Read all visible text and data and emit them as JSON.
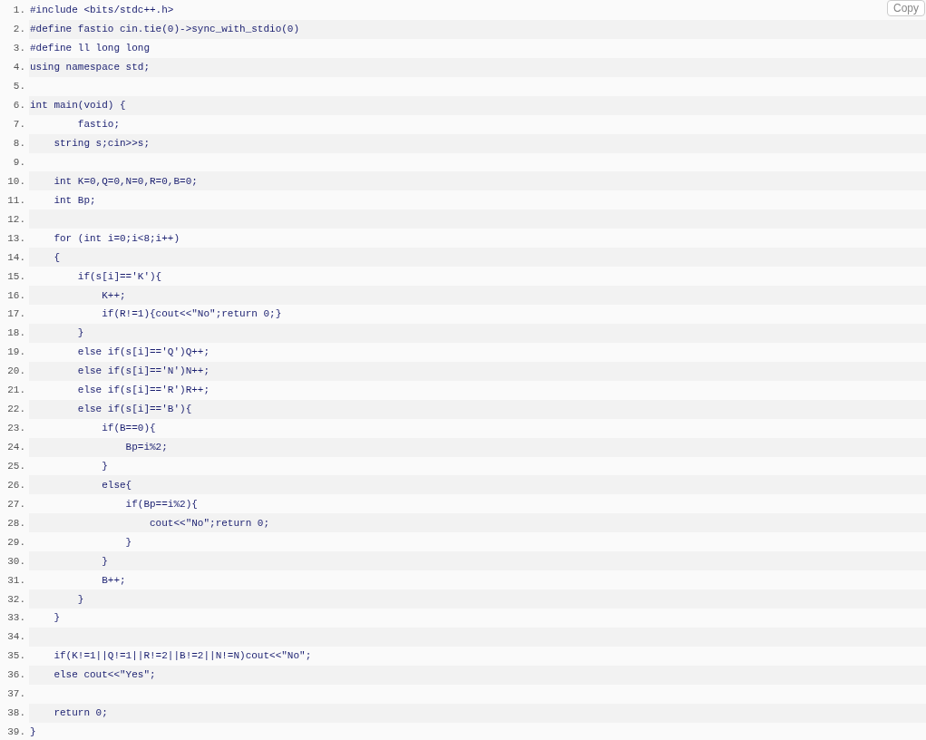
{
  "copy_button": "Copy",
  "lines": [
    {
      "number": "1.",
      "code": "#include <bits/stdc++.h>"
    },
    {
      "number": "2.",
      "code": "#define fastio cin.tie(0)->sync_with_stdio(0)"
    },
    {
      "number": "3.",
      "code": "#define ll long long"
    },
    {
      "number": "4.",
      "code": "using namespace std;"
    },
    {
      "number": "5."
    },
    {
      "number": "6.",
      "code": "int main(void) {"
    },
    {
      "number": "7.",
      "code": "        fastio;"
    },
    {
      "number": "8.",
      "code": "    string s;cin>>s;"
    },
    {
      "number": "9."
    },
    {
      "number": "10.",
      "code": "    int K=0,Q=0,N=0,R=0,B=0;"
    },
    {
      "number": "11.",
      "code": "    int Bp;"
    },
    {
      "number": "12."
    },
    {
      "number": "13.",
      "code": "    for (int i=0;i<8;i++)"
    },
    {
      "number": "14.",
      "code": "    {"
    },
    {
      "number": "15.",
      "code": "        if(s[i]=='K'){"
    },
    {
      "number": "16.",
      "code": "            K++;"
    },
    {
      "number": "17.",
      "code": "            if(R!=1){cout<<\"No\";return 0;}"
    },
    {
      "number": "18.",
      "code": "        }"
    },
    {
      "number": "19.",
      "code": "        else if(s[i]=='Q')Q++;"
    },
    {
      "number": "20.",
      "code": "        else if(s[i]=='N')N++;"
    },
    {
      "number": "21.",
      "code": "        else if(s[i]=='R')R++;"
    },
    {
      "number": "22.",
      "code": "        else if(s[i]=='B'){"
    },
    {
      "number": "23.",
      "code": "            if(B==0){"
    },
    {
      "number": "24.",
      "code": "                Bp=i%2;"
    },
    {
      "number": "25.",
      "code": "            }"
    },
    {
      "number": "26.",
      "code": "            else{"
    },
    {
      "number": "27.",
      "code": "                if(Bp==i%2){"
    },
    {
      "number": "28.",
      "code": "                    cout<<\"No\";return 0;"
    },
    {
      "number": "29.",
      "code": "                }"
    },
    {
      "number": "30.",
      "code": "            }"
    },
    {
      "number": "31.",
      "code": "            B++;"
    },
    {
      "number": "32.",
      "code": "        }"
    },
    {
      "number": "33.",
      "code": "    }"
    },
    {
      "number": "34."
    },
    {
      "number": "35.",
      "code": "    if(K!=1||Q!=1||R!=2||B!=2||N!=N)cout<<\"No\";"
    },
    {
      "number": "36.",
      "code": "    else cout<<\"Yes\";"
    },
    {
      "number": "37."
    },
    {
      "number": "38.",
      "code": "    return 0;"
    },
    {
      "number": "39.",
      "code": "}"
    }
  ]
}
